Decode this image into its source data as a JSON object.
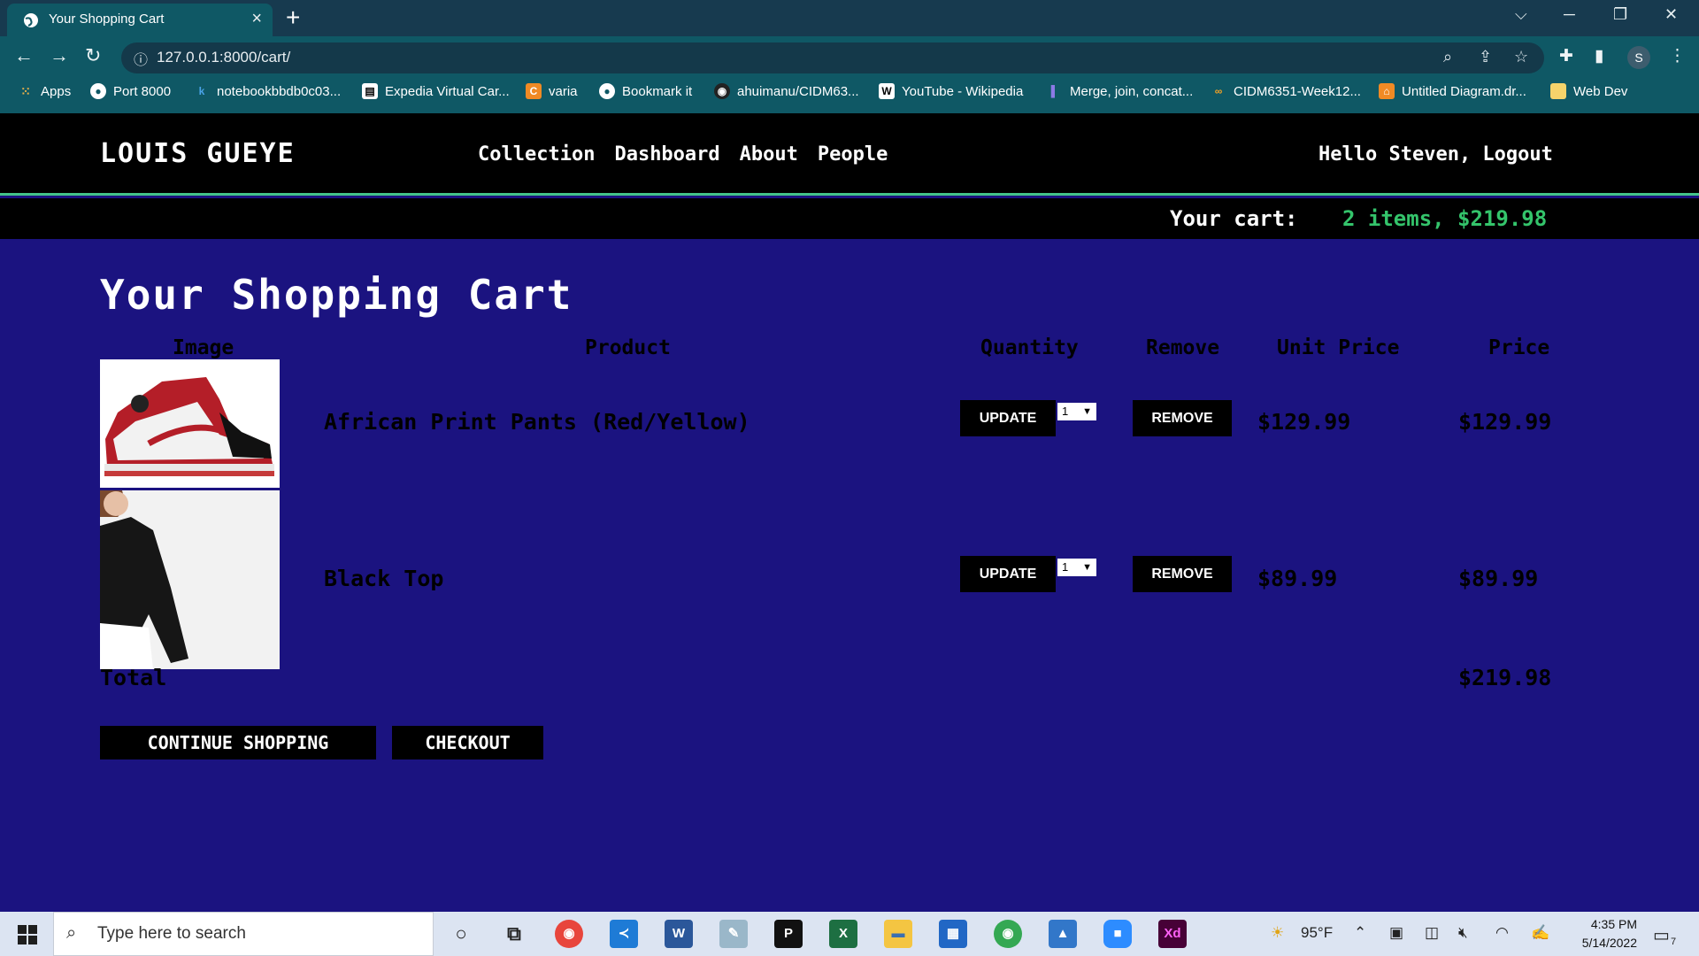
{
  "browser": {
    "tab_title": "Your Shopping Cart",
    "url": "127.0.0.1:8000/cart/",
    "profile_initial": "S",
    "bookmarks": [
      {
        "label": "Apps",
        "icon": "apps-grid-icon"
      },
      {
        "label": "Port 8000",
        "icon": "globe-icon"
      },
      {
        "label": "notebookbbdb0c03...",
        "icon": "k-icon"
      },
      {
        "label": "Expedia Virtual Car...",
        "icon": "document-icon"
      },
      {
        "label": "varia",
        "icon": "c-orange-icon"
      },
      {
        "label": "Bookmark it",
        "icon": "globe-icon"
      },
      {
        "label": "ahuimanu/CIDM63...",
        "icon": "github-icon"
      },
      {
        "label": "YouTube - Wikipedia",
        "icon": "wikipedia-icon"
      },
      {
        "label": "Merge, join, concat...",
        "icon": "pandas-icon"
      },
      {
        "label": "CIDM6351-Week12...",
        "icon": "colab-icon"
      },
      {
        "label": "Untitled Diagram.dr...",
        "icon": "drawio-icon"
      },
      {
        "label": "Web Dev",
        "icon": "folder-icon"
      }
    ]
  },
  "site": {
    "brand": "LOUIS GUEYE",
    "nav": [
      "Collection",
      "Dashboard",
      "About",
      "People"
    ],
    "greeting": "Hello Steven, Logout",
    "cart_label": "Your cart:",
    "cart_summary": "2 items, $219.98"
  },
  "cart": {
    "heading": "Your Shopping Cart",
    "headers": {
      "image": "Image",
      "product": "Product",
      "quantity": "Quantity",
      "remove": "Remove",
      "unit_price": "Unit Price",
      "price": "Price"
    },
    "update_label": "UPDATE",
    "remove_label": "REMOVE",
    "items": [
      {
        "name": "African Print Pants (Red/Yellow)",
        "quantity": "1",
        "unit_price": "$129.99",
        "price": "$129.99",
        "image": "red-sneaker-image"
      },
      {
        "name": "Black Top",
        "quantity": "1",
        "unit_price": "$89.99",
        "price": "$89.99",
        "image": "black-top-image"
      }
    ],
    "total_label": "Total",
    "total_value": "$219.98",
    "continue_label": "CONTINUE SHOPPING",
    "checkout_label": "CHECKOUT"
  },
  "taskbar": {
    "search_placeholder": "Type here to search",
    "weather": "95°F",
    "time": "4:35 PM",
    "date": "5/14/2022",
    "notification_count": "7"
  }
}
